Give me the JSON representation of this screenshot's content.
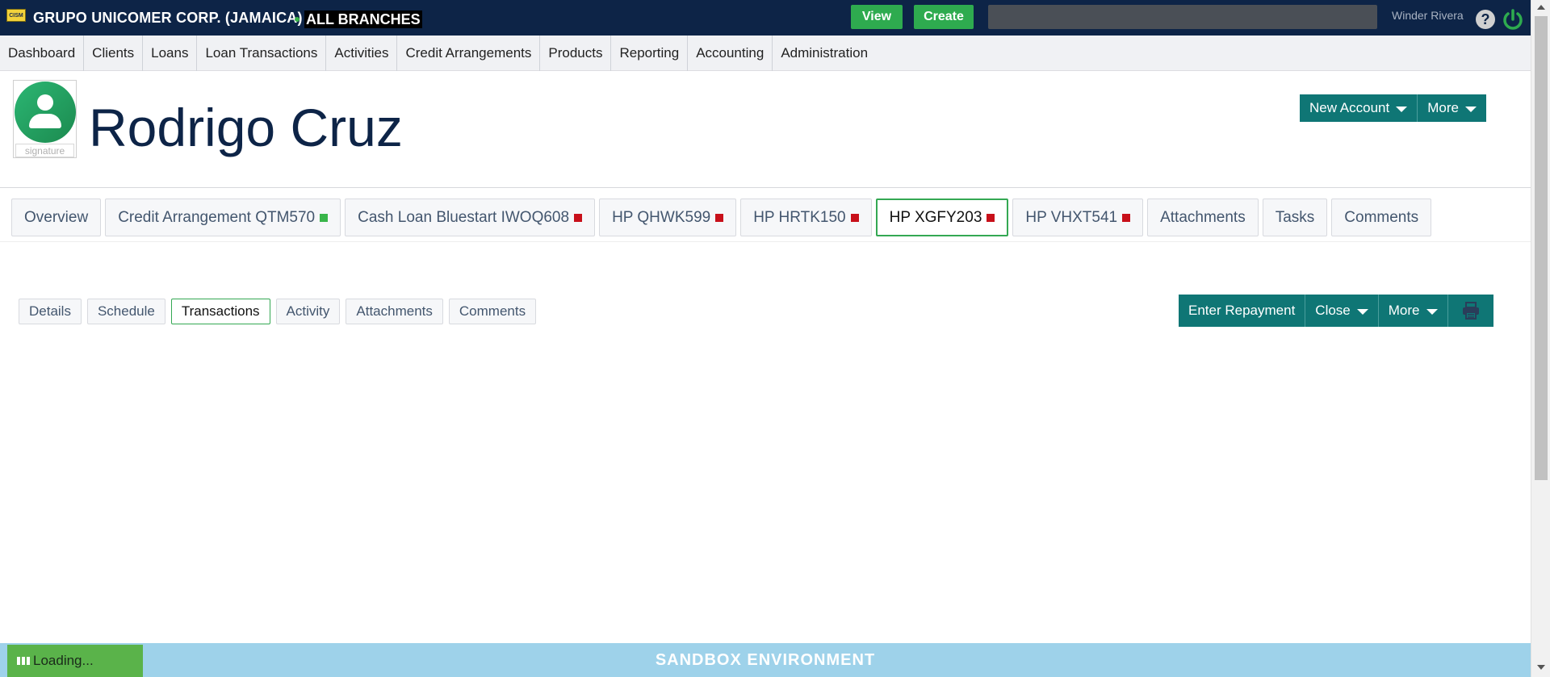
{
  "topbar": {
    "logo_text": "CISM",
    "org_name": "GRUPO UNICOMER CORP. (JAMAICA)",
    "branch": "ALL BRANCHES",
    "view_label": "View",
    "create_label": "Create",
    "search_placeholder": "",
    "user_name": "Winder Rivera",
    "help_glyph": "?"
  },
  "menu": {
    "items": [
      "Dashboard",
      "Clients",
      "Loans",
      "Loan Transactions",
      "Activities",
      "Credit Arrangements",
      "Products",
      "Reporting",
      "Accounting",
      "Administration"
    ]
  },
  "client": {
    "name": "Rodrigo Cruz",
    "signature_label": "signature",
    "new_account_label": "New Account",
    "more_label": "More"
  },
  "account_tabs": [
    {
      "label": "Overview",
      "status": ""
    },
    {
      "label": "Credit Arrangement QTM570",
      "status": "green"
    },
    {
      "label": "Cash Loan Bluestart IWOQ608",
      "status": "red"
    },
    {
      "label": "HP QHWK599",
      "status": "red"
    },
    {
      "label": "HP HRTK150",
      "status": "red"
    },
    {
      "label": "HP XGFY203",
      "status": "red",
      "active": true
    },
    {
      "label": "HP VHXT541",
      "status": "red"
    },
    {
      "label": "Attachments",
      "status": ""
    },
    {
      "label": "Tasks",
      "status": ""
    },
    {
      "label": "Comments",
      "status": ""
    }
  ],
  "sub_tabs": [
    {
      "label": "Details"
    },
    {
      "label": "Schedule"
    },
    {
      "label": "Transactions",
      "active": true
    },
    {
      "label": "Activity"
    },
    {
      "label": "Attachments"
    },
    {
      "label": "Comments"
    }
  ],
  "account_actions": {
    "enter_repayment_label": "Enter Repayment",
    "close_label": "Close",
    "more_label": "More"
  },
  "footer": {
    "loading_label": "Loading...",
    "sandbox_label": "SANDBOX ENVIRONMENT"
  },
  "colors": {
    "topbar": "#0d2447",
    "accent_green": "#2eab4f",
    "teal": "#0f7675",
    "status_red": "#c8101a",
    "status_green": "#39b54a",
    "sandbox": "#9ed2ea"
  }
}
